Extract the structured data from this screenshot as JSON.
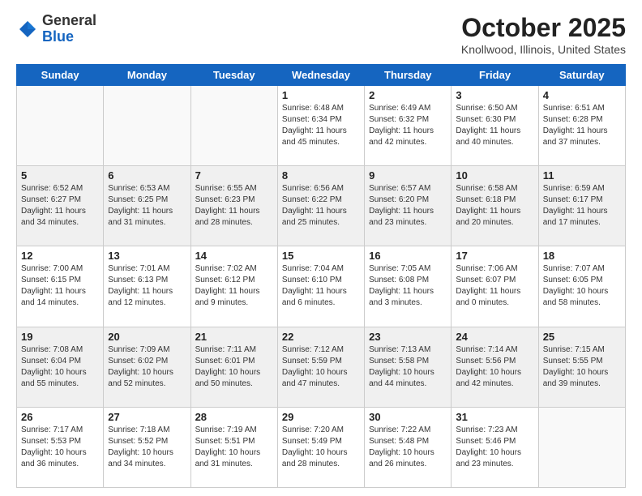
{
  "logo": {
    "general": "General",
    "blue": "Blue"
  },
  "title": "October 2025",
  "location": "Knollwood, Illinois, United States",
  "days_of_week": [
    "Sunday",
    "Monday",
    "Tuesday",
    "Wednesday",
    "Thursday",
    "Friday",
    "Saturday"
  ],
  "weeks": [
    [
      {
        "day": "",
        "info": ""
      },
      {
        "day": "",
        "info": ""
      },
      {
        "day": "",
        "info": ""
      },
      {
        "day": "1",
        "info": "Sunrise: 6:48 AM\nSunset: 6:34 PM\nDaylight: 11 hours\nand 45 minutes."
      },
      {
        "day": "2",
        "info": "Sunrise: 6:49 AM\nSunset: 6:32 PM\nDaylight: 11 hours\nand 42 minutes."
      },
      {
        "day": "3",
        "info": "Sunrise: 6:50 AM\nSunset: 6:30 PM\nDaylight: 11 hours\nand 40 minutes."
      },
      {
        "day": "4",
        "info": "Sunrise: 6:51 AM\nSunset: 6:28 PM\nDaylight: 11 hours\nand 37 minutes."
      }
    ],
    [
      {
        "day": "5",
        "info": "Sunrise: 6:52 AM\nSunset: 6:27 PM\nDaylight: 11 hours\nand 34 minutes."
      },
      {
        "day": "6",
        "info": "Sunrise: 6:53 AM\nSunset: 6:25 PM\nDaylight: 11 hours\nand 31 minutes."
      },
      {
        "day": "7",
        "info": "Sunrise: 6:55 AM\nSunset: 6:23 PM\nDaylight: 11 hours\nand 28 minutes."
      },
      {
        "day": "8",
        "info": "Sunrise: 6:56 AM\nSunset: 6:22 PM\nDaylight: 11 hours\nand 25 minutes."
      },
      {
        "day": "9",
        "info": "Sunrise: 6:57 AM\nSunset: 6:20 PM\nDaylight: 11 hours\nand 23 minutes."
      },
      {
        "day": "10",
        "info": "Sunrise: 6:58 AM\nSunset: 6:18 PM\nDaylight: 11 hours\nand 20 minutes."
      },
      {
        "day": "11",
        "info": "Sunrise: 6:59 AM\nSunset: 6:17 PM\nDaylight: 11 hours\nand 17 minutes."
      }
    ],
    [
      {
        "day": "12",
        "info": "Sunrise: 7:00 AM\nSunset: 6:15 PM\nDaylight: 11 hours\nand 14 minutes."
      },
      {
        "day": "13",
        "info": "Sunrise: 7:01 AM\nSunset: 6:13 PM\nDaylight: 11 hours\nand 12 minutes."
      },
      {
        "day": "14",
        "info": "Sunrise: 7:02 AM\nSunset: 6:12 PM\nDaylight: 11 hours\nand 9 minutes."
      },
      {
        "day": "15",
        "info": "Sunrise: 7:04 AM\nSunset: 6:10 PM\nDaylight: 11 hours\nand 6 minutes."
      },
      {
        "day": "16",
        "info": "Sunrise: 7:05 AM\nSunset: 6:08 PM\nDaylight: 11 hours\nand 3 minutes."
      },
      {
        "day": "17",
        "info": "Sunrise: 7:06 AM\nSunset: 6:07 PM\nDaylight: 11 hours\nand 0 minutes."
      },
      {
        "day": "18",
        "info": "Sunrise: 7:07 AM\nSunset: 6:05 PM\nDaylight: 10 hours\nand 58 minutes."
      }
    ],
    [
      {
        "day": "19",
        "info": "Sunrise: 7:08 AM\nSunset: 6:04 PM\nDaylight: 10 hours\nand 55 minutes."
      },
      {
        "day": "20",
        "info": "Sunrise: 7:09 AM\nSunset: 6:02 PM\nDaylight: 10 hours\nand 52 minutes."
      },
      {
        "day": "21",
        "info": "Sunrise: 7:11 AM\nSunset: 6:01 PM\nDaylight: 10 hours\nand 50 minutes."
      },
      {
        "day": "22",
        "info": "Sunrise: 7:12 AM\nSunset: 5:59 PM\nDaylight: 10 hours\nand 47 minutes."
      },
      {
        "day": "23",
        "info": "Sunrise: 7:13 AM\nSunset: 5:58 PM\nDaylight: 10 hours\nand 44 minutes."
      },
      {
        "day": "24",
        "info": "Sunrise: 7:14 AM\nSunset: 5:56 PM\nDaylight: 10 hours\nand 42 minutes."
      },
      {
        "day": "25",
        "info": "Sunrise: 7:15 AM\nSunset: 5:55 PM\nDaylight: 10 hours\nand 39 minutes."
      }
    ],
    [
      {
        "day": "26",
        "info": "Sunrise: 7:17 AM\nSunset: 5:53 PM\nDaylight: 10 hours\nand 36 minutes."
      },
      {
        "day": "27",
        "info": "Sunrise: 7:18 AM\nSunset: 5:52 PM\nDaylight: 10 hours\nand 34 minutes."
      },
      {
        "day": "28",
        "info": "Sunrise: 7:19 AM\nSunset: 5:51 PM\nDaylight: 10 hours\nand 31 minutes."
      },
      {
        "day": "29",
        "info": "Sunrise: 7:20 AM\nSunset: 5:49 PM\nDaylight: 10 hours\nand 28 minutes."
      },
      {
        "day": "30",
        "info": "Sunrise: 7:22 AM\nSunset: 5:48 PM\nDaylight: 10 hours\nand 26 minutes."
      },
      {
        "day": "31",
        "info": "Sunrise: 7:23 AM\nSunset: 5:46 PM\nDaylight: 10 hours\nand 23 minutes."
      },
      {
        "day": "",
        "info": ""
      }
    ]
  ]
}
